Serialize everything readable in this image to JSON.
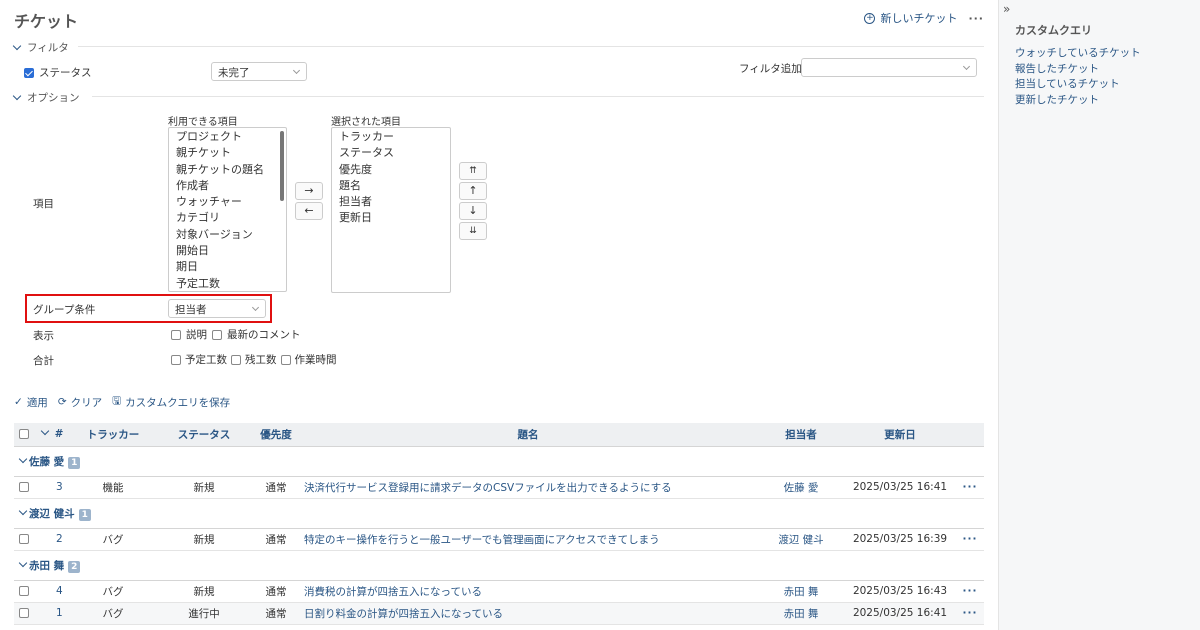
{
  "page": {
    "title": "チケット",
    "new_issue": "新しいチケット",
    "more": "···"
  },
  "filters": {
    "legend": "フィルタ",
    "status_label": "ステータス",
    "status_value": "未完了",
    "add_filter_label": "フィルタ追加",
    "add_filter_value": ""
  },
  "options": {
    "legend": "オプション",
    "columns_label": "項目",
    "available_label": "利用できる項目",
    "available": [
      "プロジェクト",
      "親チケット",
      "親チケットの題名",
      "作成者",
      "ウォッチャー",
      "カテゴリ",
      "対象バージョン",
      "開始日",
      "期日",
      "予定工数"
    ],
    "selected_label": "選択された項目",
    "selected": [
      "トラッカー",
      "ステータス",
      "優先度",
      "題名",
      "担当者",
      "更新日"
    ],
    "move_right": "→",
    "move_left": "←",
    "move_top": "⇈",
    "move_up": "↑",
    "move_down": "↓",
    "move_bottom": "⇊",
    "group_label": "グループ条件",
    "group_value": "担当者",
    "display_label": "表示",
    "display_items": [
      "説明",
      "最新のコメント"
    ],
    "totals_label": "合計",
    "totals_items": [
      "予定工数",
      "残工数",
      "作業時間"
    ]
  },
  "actions": {
    "apply": "適用",
    "clear": "クリア",
    "save": "カスタムクエリを保存"
  },
  "table": {
    "headers": {
      "id": "#",
      "tracker": "トラッカー",
      "status": "ステータス",
      "priority": "優先度",
      "subject": "題名",
      "assignee": "担当者",
      "updated": "更新日"
    },
    "groups": [
      {
        "name": "佐藤 愛",
        "count": "1",
        "rows": [
          {
            "id": "3",
            "tracker": "機能",
            "status": "新規",
            "priority": "通常",
            "subject": "決済代行サービス登録用に請求データのCSVファイルを出力できるようにする",
            "assignee": "佐藤 愛",
            "updated": "2025/03/25 16:41"
          }
        ]
      },
      {
        "name": "渡辺 健斗",
        "count": "1",
        "rows": [
          {
            "id": "2",
            "tracker": "バグ",
            "status": "新規",
            "priority": "通常",
            "subject": "特定のキー操作を行うと一般ユーザーでも管理画面にアクセスできてしまう",
            "assignee": "渡辺 健斗",
            "updated": "2025/03/25 16:39"
          }
        ]
      },
      {
        "name": "赤田 舞",
        "count": "2",
        "rows": [
          {
            "id": "4",
            "tracker": "バグ",
            "status": "新規",
            "priority": "通常",
            "subject": "消費税の計算が四捨五入になっている",
            "assignee": "赤田 舞",
            "updated": "2025/03/25 16:43"
          },
          {
            "id": "1",
            "tracker": "バグ",
            "status": "進行中",
            "priority": "通常",
            "subject": "日割り料金の計算が四捨五入になっている",
            "assignee": "赤田 舞",
            "updated": "2025/03/25 16:41"
          }
        ]
      }
    ],
    "row_menu": "···"
  },
  "sidebar": {
    "toggle": "»",
    "title": "カスタムクエリ",
    "items": [
      "ウォッチしているチケット",
      "報告したチケット",
      "担当しているチケット",
      "更新したチケット"
    ]
  }
}
